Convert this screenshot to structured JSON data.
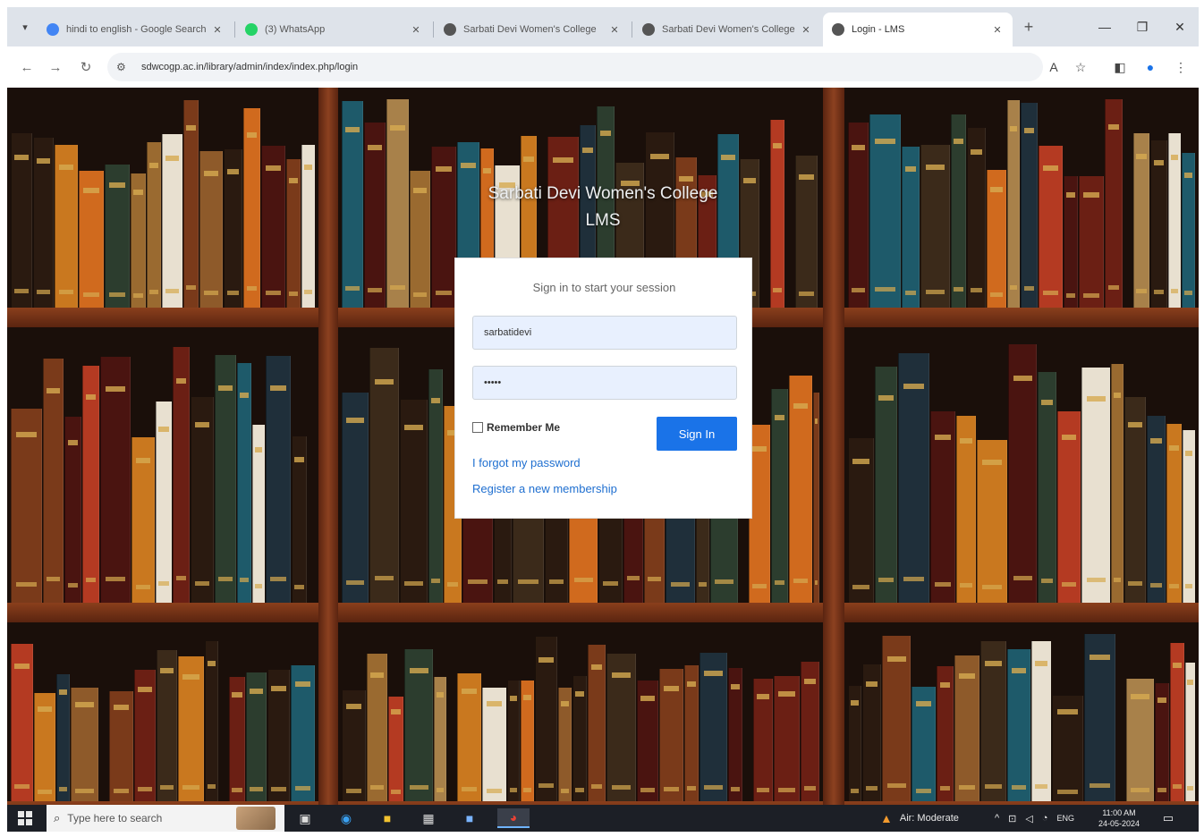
{
  "browser": {
    "tabs": [
      {
        "title": "hindi to english - Google Search",
        "favicon_color": "#4285f4"
      },
      {
        "title": "(3) WhatsApp",
        "favicon_color": "#25d366"
      },
      {
        "title": "Sarbati Devi Women's College",
        "favicon_color": "#555555"
      },
      {
        "title": "Sarbati Devi Women's College",
        "favicon_color": "#555555"
      },
      {
        "title": "Login - LMS",
        "favicon_color": "#555555"
      }
    ],
    "url": "sdwcogp.ac.in/library/admin/index/index.php/login",
    "icons": {
      "back": "back-arrow-icon",
      "forward": "forward-arrow-icon",
      "reload": "reload-icon",
      "site_info": "site-info-icon",
      "translate": "translate-icon",
      "bookmark": "star-icon",
      "sidepanel": "side-panel-icon",
      "profile": "profile-icon",
      "menu": "kebab-menu-icon"
    }
  },
  "page": {
    "college_name": "Sarbati Devi Women's College",
    "app_name": "LMS",
    "login_message": "Sign in to start your session",
    "username_value": "sarbatidevi",
    "password_value": "•••••",
    "remember_label": "Remember Me",
    "signin_label": "Sign In",
    "forgot_link": "I forgot my password",
    "register_link": "Register a new membership"
  },
  "taskbar": {
    "search_placeholder": "Type here to search",
    "weather": "Air: Moderate",
    "language": "ENG",
    "time": "11:00 AM",
    "date": "24-05-2024"
  },
  "colors": {
    "accent": "#1a73e8",
    "link": "#1f6fd0",
    "field_bg": "#e8f0fe"
  }
}
